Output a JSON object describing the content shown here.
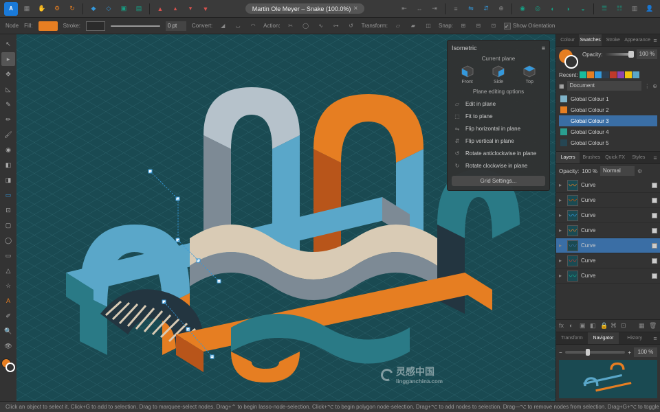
{
  "app": {
    "logo": "A",
    "doc_title": "Martin Ole Meyer – Snake (100.0%)"
  },
  "topbar": {
    "groups": [
      [
        "grid-icon",
        "hand-icon",
        "gear-icon",
        "refresh-icon"
      ],
      [
        "anchor-icon",
        "control-icon",
        "group-icon",
        "merge-icon",
        "front-icon",
        "back-icon"
      ],
      [
        "align-left-icon",
        "align-center-icon",
        "align-right-icon",
        "align-top-icon",
        "align-middle-icon",
        "align-bottom-icon"
      ],
      [
        "distribute-h-icon",
        "distribute-v-icon",
        "flip-h-icon",
        "flip-v-icon"
      ],
      [
        "boolean-add-icon",
        "boolean-sub-icon",
        "boolean-intersect-icon",
        "boolean-xor-icon",
        "boolean-divide-icon"
      ],
      [
        "insert-icon",
        "snapshot-icon",
        "user-icon"
      ]
    ]
  },
  "context": {
    "mode": "Node",
    "fill_label": "Fill:",
    "stroke_label": "Stroke:",
    "stroke_width": "0 pt",
    "convert_label": "Convert:",
    "action_label": "Action:",
    "transform_label": "Transform:",
    "snap_label": "Snap:",
    "show_orientation": "Show Orientation"
  },
  "left_tools": [
    "move-tool",
    "node-tool",
    "point-transform-tool",
    "corner-tool",
    "pen-tool",
    "pencil-tool",
    "brush-tool",
    "fill-tool",
    "gradient-tool",
    "transparency-tool",
    "place-image-tool",
    "crop-tool",
    "shape-rect-tool",
    "shape-ellipse-tool",
    "shape-rounded-tool",
    "shape-triangle-tool",
    "shape-star-tool",
    "artistic-text-tool",
    "color-picker-tool",
    "zoom-tool",
    "view-tool"
  ],
  "isometric": {
    "title": "Isometric",
    "current_plane_label": "Current plane",
    "planes": [
      {
        "name": "Front"
      },
      {
        "name": "Side"
      },
      {
        "name": "Top"
      }
    ],
    "editing_label": "Plane editing options",
    "options": [
      "Edit in plane",
      "Fit to plane",
      "Flip horizontal in plane",
      "Flip vertical in plane",
      "Rotate anticlockwise in plane",
      "Rotate clockwise in plane"
    ],
    "grid_settings": "Grid Settings..."
  },
  "right": {
    "swatches": {
      "tabs": [
        "Colour",
        "Swatches",
        "Stroke",
        "Appearance"
      ],
      "active_tab": 1,
      "opacity_label": "Opacity:",
      "opacity_value": "100 %",
      "recent_label": "Recent:",
      "recent_colors": [
        "#1abc9c",
        "#e67e22",
        "#3498db",
        "#2c3e50",
        "#c0392b",
        "#8e44ad",
        "#f1c40f",
        "#5aa7c9"
      ],
      "doc_dropdown": "Document",
      "global_colours": [
        {
          "name": "Global Colour 1",
          "color": "#7fb3c9"
        },
        {
          "name": "Global Colour 2",
          "color": "#e67e22"
        },
        {
          "name": "Global Colour 3",
          "color": "#3a6ea5",
          "selected": true
        },
        {
          "name": "Global Colour 4",
          "color": "#2a9d8f"
        },
        {
          "name": "Global Colour 5",
          "color": "#264653"
        }
      ]
    },
    "layers": {
      "tabs": [
        "Layers",
        "Brushes",
        "Quick FX",
        "Styles"
      ],
      "active_tab": 0,
      "opacity_label": "Opacity:",
      "opacity_value": "100 %",
      "blend_mode": "Normal",
      "items": [
        {
          "name": "Curve",
          "thumb": "〰",
          "tc": "#e67e22"
        },
        {
          "name": "Curve",
          "thumb": "〰",
          "tc": "#d35400"
        },
        {
          "name": "Curve",
          "thumb": "〰",
          "tc": "#3498db"
        },
        {
          "name": "Curve",
          "thumb": "〰",
          "tc": "#e67e22"
        },
        {
          "name": "Curve",
          "thumb": "〰",
          "tc": "#3a6ea5",
          "selected": true
        },
        {
          "name": "Curve",
          "thumb": "〰",
          "tc": "#c0392b"
        },
        {
          "name": "Curve",
          "thumb": "〰",
          "tc": "#16a085"
        }
      ]
    },
    "navigator": {
      "tabs": [
        "Transform",
        "Navigator",
        "History"
      ],
      "active_tab": 1,
      "zoom": "100 %"
    }
  },
  "statusbar": "Click an object to select it. Click+G to add to selection. Drag to marquee-select nodes. Drag+⌃ to begin lasso-node-selection. Click+⌥ to begin polygon node-selection. Drag+⌥ to add nodes to selection. Drag-–⌥ to remove nodes from selection. Drag+G+⌥ to toggle node selection.",
  "watermark": {
    "cn": "灵感中国",
    "en": "lingganchina.com"
  },
  "palette": {
    "teal_dark": "#1a4a52",
    "teal": "#2a7a86",
    "teal_light": "#5aa7c9",
    "orange": "#e67e22",
    "orange_dark": "#b8551a",
    "grey": "#7d8a95",
    "grey_light": "#b6c2cb",
    "cream": "#d9cbb5",
    "navy": "#233540"
  }
}
